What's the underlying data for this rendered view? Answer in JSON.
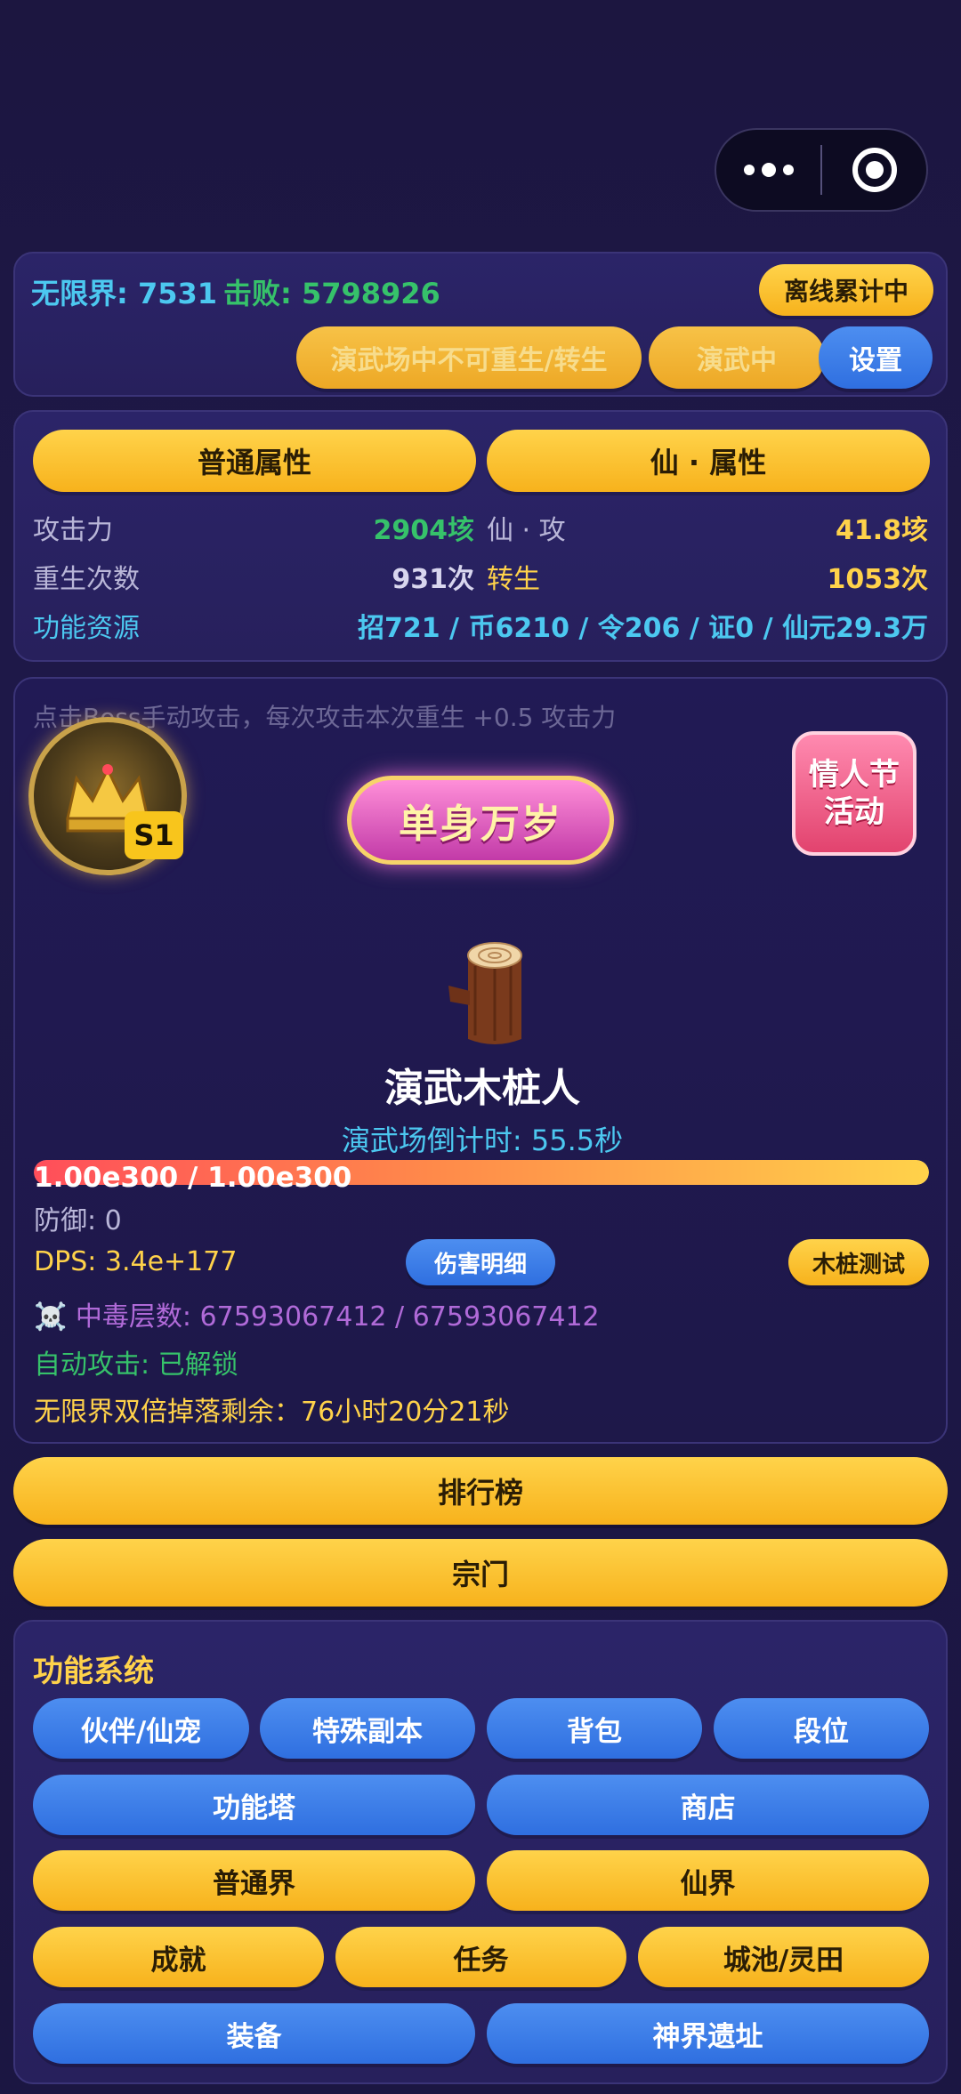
{
  "status": {
    "realm_label": "无限界: 7531",
    "kills_label": "击败: 5798926",
    "offline_btn": "离线累计中",
    "rebirth_btn": "演武场中不可重生/转生",
    "training_btn": "演武中",
    "settings_btn": "设置"
  },
  "attributes": {
    "tab_normal": "普通属性",
    "tab_immortal": "仙 · 属性",
    "rows": [
      {
        "left_label": "攻击力",
        "left_value": "2904垓",
        "right_label": "仙 · 攻",
        "right_value": "41.8垓"
      },
      {
        "left_label": "重生次数",
        "left_value": "931次",
        "right_label": "转生",
        "right_value": "1053次"
      }
    ],
    "resource_label": "功能资源",
    "resource_value": "招721 / 币6210 / 令206 / 证0 / 仙元29.3万"
  },
  "battle": {
    "hint": "点击Boss手动攻击，每次攻击本次重生 +0.5 攻击力",
    "season_badge": "S1",
    "banner_text": "单身万岁",
    "event_line1": "情人节",
    "event_line2": "活动",
    "target_name": "演武木桩人",
    "countdown": "演武场倒计时: 55.5秒",
    "hp_text": "1.00e300 / 1.00e300",
    "hp_fraction": 1.0,
    "defense": "防御: 0",
    "dps": "DPS: 3.4e+177",
    "damage_detail_btn": "伤害明细",
    "stump_test_btn": "木桩测试",
    "poison_icon": "☠️",
    "poison": "中毒层数: 67593067412 / 67593067412",
    "auto_attack": "自动攻击: 已解锁",
    "double_drop": "无限界双倍掉落剩余：76小时20分21秒"
  },
  "main_buttons": {
    "leaderboard": "排行榜",
    "sect": "宗门"
  },
  "features": {
    "title": "功能系统",
    "row1": [
      "伙伴/仙宠",
      "特殊副本",
      "背包",
      "段位"
    ],
    "row2": [
      "功能塔",
      "商店"
    ],
    "row3": [
      "普通界",
      "仙界"
    ],
    "row4": [
      "成就",
      "任务",
      "城池/灵田"
    ],
    "row5": [
      "装备",
      "神界遗址"
    ]
  },
  "colors": {
    "gold": "#f7b21c",
    "blue": "#3a7ce8",
    "cyan": "#4cc8f0",
    "green": "#36c26a",
    "purple": "#b06ad8",
    "yellow_text": "#ffd24a"
  }
}
